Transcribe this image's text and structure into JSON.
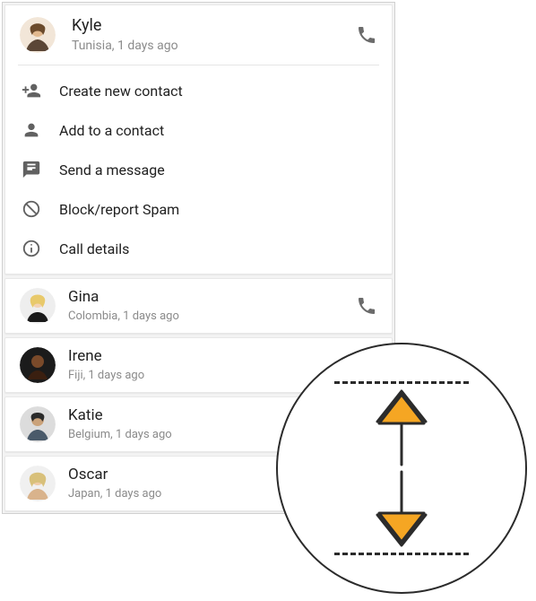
{
  "expanded": {
    "name": "Kyle",
    "meta": "Tunisia, 1 days ago",
    "menu": {
      "create": "Create new contact",
      "add": "Add to a contact",
      "message": "Send a message",
      "block": "Block/report Spam",
      "details": "Call details"
    }
  },
  "contacts": [
    {
      "name": "Gina",
      "meta": "Colombia, 1 days ago",
      "has_call_icon": true
    },
    {
      "name": "Irene",
      "meta": "Fiji, 1 days ago",
      "has_call_icon": false
    },
    {
      "name": "Katie",
      "meta": "Belgium, 1 days ago",
      "has_call_icon": false
    },
    {
      "name": "Oscar",
      "meta": "Japan, 1 days ago",
      "has_call_icon": false
    }
  ],
  "colors": {
    "accent": "#F5A623",
    "stroke": "#2b2b2b"
  },
  "gesture": {
    "description": "scroll-up-down-gesture"
  }
}
